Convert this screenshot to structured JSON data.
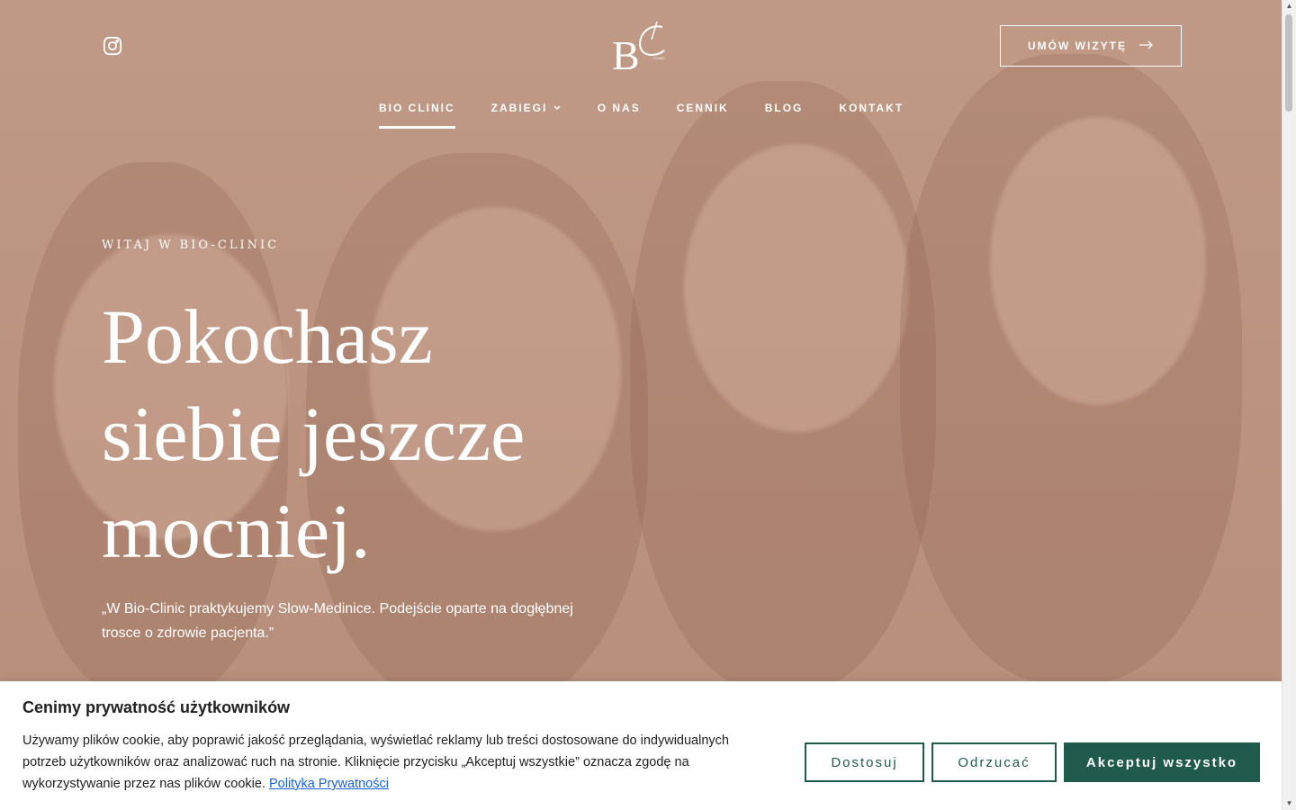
{
  "header": {
    "cta_label": "UMÓW WIZYTĘ",
    "nav": [
      {
        "label": "BIO CLINIC"
      },
      {
        "label": "ZABIEGI"
      },
      {
        "label": "O NAS"
      },
      {
        "label": "CENNIK"
      },
      {
        "label": "BLOG"
      },
      {
        "label": "KONTAKT"
      }
    ]
  },
  "hero": {
    "eyebrow": "WITAJ W BIO-CLINIC",
    "headline_line1": "Pokochasz",
    "headline_line2": "siebie jeszcze",
    "headline_line3": "mocniej.",
    "quote_line1": "„W Bio-Clinic praktykujemy Slow-Medinice. Podejście oparte na dogłębnej",
    "quote_line2": "trosce o zdrowie pacjenta.”"
  },
  "cookie": {
    "title": "Cenimy prywatność użytkowników",
    "text_line1": "Używamy plików cookie, aby poprawić jakość przeglądania, wyświetlać reklamy lub treści dostosowane do indywidualnych",
    "text_line2": "potrzeb użytkowników oraz analizować ruch na stronie. Kliknięcie przycisku „Akceptuj wszystkie” oznacza zgodę na",
    "text_line3": "wykorzystywanie przez nas plików cookie.",
    "policy_link": "Polityka Prywatności",
    "customize": "Dostosuj",
    "reject": "Odrzucać",
    "accept": "Akceptuj wszystko"
  },
  "colors": {
    "hero_bg": "#bb9380",
    "brand_green": "#1f5a4c",
    "link": "#1863dc"
  },
  "icons": {
    "social": "instagram-icon",
    "logo": "bc-logo",
    "cta_arrow": "arrow-right-icon",
    "dropdown": "chevron-down-icon"
  }
}
